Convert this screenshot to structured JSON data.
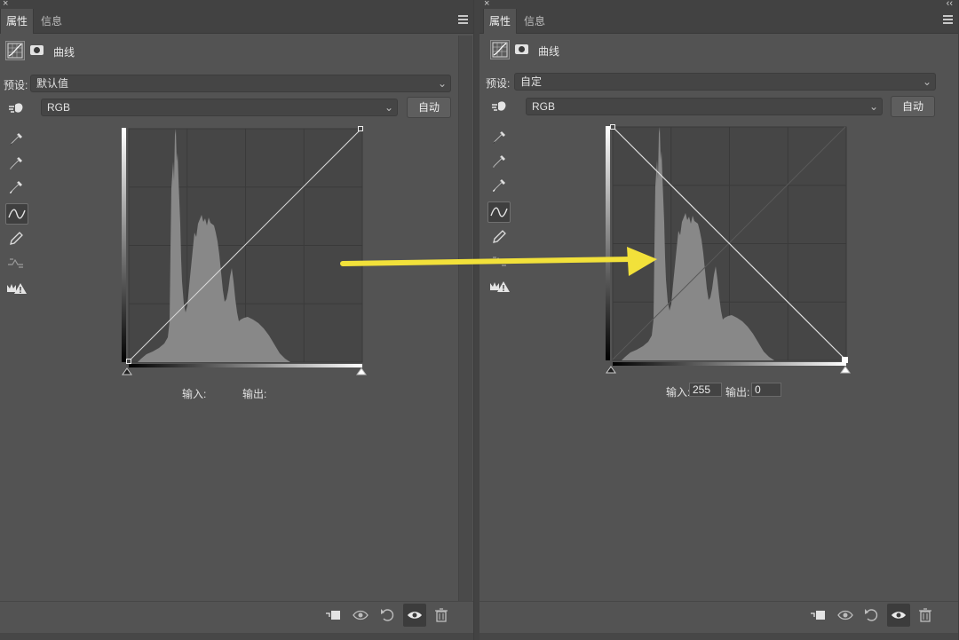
{
  "panels": [
    {
      "tabs": [
        "属性",
        "信息"
      ],
      "header_label": "曲线",
      "preset_label": "预设:",
      "preset_value": "默认值",
      "channel": "RGB",
      "auto_button": "自动",
      "input_label": "输入:",
      "output_label": "输出:",
      "input_value": "",
      "output_value": "",
      "curve": "diagonal-up"
    },
    {
      "tabs": [
        "属性",
        "信息"
      ],
      "header_label": "曲线",
      "preset_label": "预设:",
      "preset_value": "自定",
      "channel": "RGB",
      "auto_button": "自动",
      "input_label": "输入:",
      "output_label": "输出:",
      "input_value": "255",
      "output_value": "0",
      "curve": "inverted"
    }
  ],
  "colors": {
    "panel_bg": "#535353",
    "graph_bg": "#464646",
    "histogram": "#888888",
    "arrow": "#f2e13a"
  },
  "icons": {
    "close": "×",
    "collapse": "‹‹",
    "chevron": "⌄"
  }
}
